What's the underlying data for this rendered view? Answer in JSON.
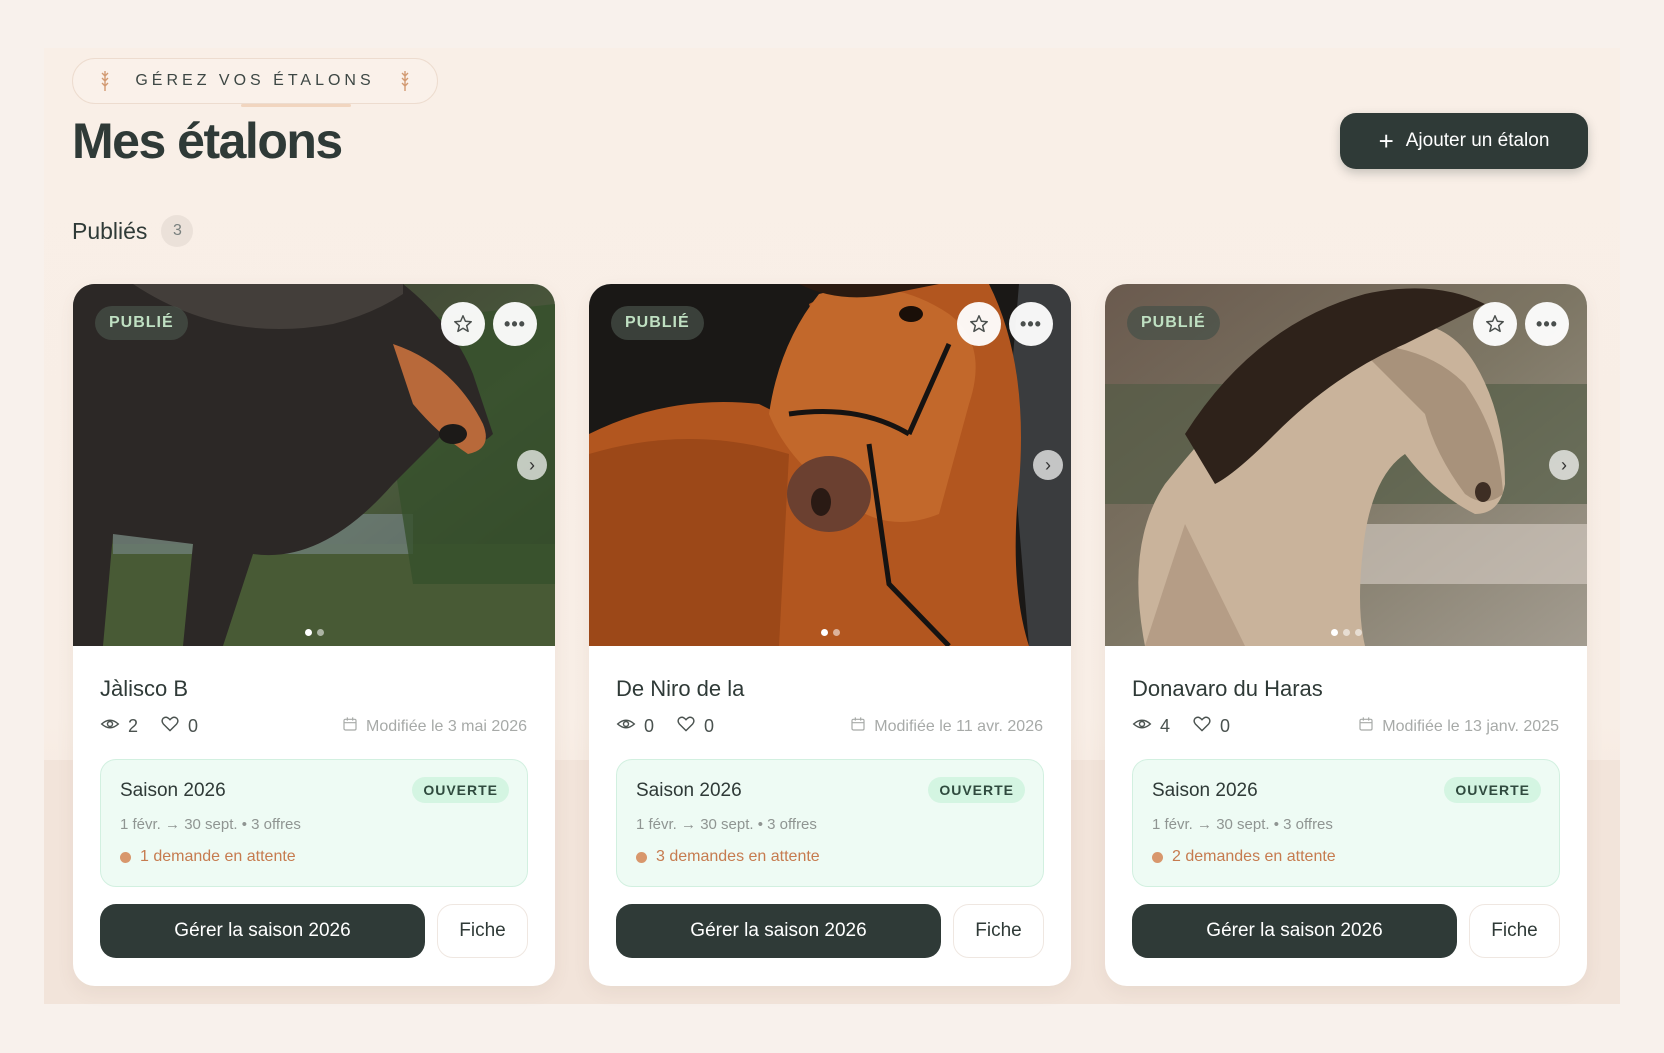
{
  "header": {
    "eyebrow": "GÉREZ VOS ÉTALONS",
    "title": "Mes étalons",
    "add_button": "Ajouter un étalon"
  },
  "section": {
    "label": "Publiés",
    "count": "3"
  },
  "cards": [
    {
      "status": "PUBLIÉ",
      "name": "Jàlisco B",
      "views": "2",
      "likes": "0",
      "modified": "Modifiée le 3 mai 2026",
      "season": {
        "title": "Saison 2026",
        "state": "OUVERTE",
        "range": "1 févr. → 30 sept. • 3 offres",
        "pending": "1 demande en attente"
      },
      "manage_label": "Gérer la saison 2026",
      "fiche_label": "Fiche"
    },
    {
      "status": "PUBLIÉ",
      "name": "De Niro de la",
      "views": "0",
      "likes": "0",
      "modified": "Modifiée le 11 avr. 2026",
      "season": {
        "title": "Saison 2026",
        "state": "OUVERTE",
        "range": "1 févr. → 30 sept. • 3 offres",
        "pending": "3 demandes en attente"
      },
      "manage_label": "Gérer la saison 2026",
      "fiche_label": "Fiche"
    },
    {
      "status": "PUBLIÉ",
      "name": "Donavaro du Haras",
      "views": "4",
      "likes": "0",
      "modified": "Modifiée le 13 janv. 2025",
      "season": {
        "title": "Saison 2026",
        "state": "OUVERTE",
        "range": "1 févr. → 30 sept. • 3 offres",
        "pending": "2 demandes en attente"
      },
      "manage_label": "Gérer la saison 2026",
      "fiche_label": "Fiche"
    }
  ],
  "icons": {
    "eyebrow": "wheat-icon",
    "add": "plus-icon",
    "favorite": "star-icon",
    "menu": "more-icon",
    "next": "chevron-right-icon",
    "views": "eye-icon",
    "likes": "heart-icon",
    "date": "calendar-icon"
  },
  "colors": {
    "primary": "#2f3a37",
    "background": "#f8f1ec",
    "season_bg": "#eefbf4",
    "pending": "#c67b4f",
    "badge_text": "#bfe0c2"
  }
}
